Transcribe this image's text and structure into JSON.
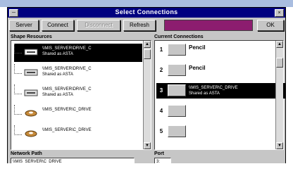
{
  "window": {
    "title": "Select Connections"
  },
  "toolbar": {
    "buttons": [
      {
        "label": "Server"
      },
      {
        "label": "Connect"
      },
      {
        "label": "Disconnect"
      },
      {
        "label": "Refresh"
      },
      {
        "label": "OK"
      }
    ]
  },
  "resources": {
    "label": "Shape Resources",
    "items": [
      {
        "line1": "\\\\MIS_SERVER\\DRIVE_C",
        "line2": "Shared as ASTA",
        "icon": "printer-icon",
        "selected": true
      },
      {
        "line1": "\\\\MIS_SERVER\\DRIVE_C",
        "line2": "Shared as ASTA",
        "icon": "printer-icon",
        "selected": false
      },
      {
        "line1": "\\\\MIS_SERVER\\DRIVE_C",
        "line2": "Shared as ASTA",
        "icon": "printer-icon",
        "selected": false
      },
      {
        "line1": "\\\\MIS_SERVER\\C_DRIVE",
        "line2": "",
        "icon": "disk-icon",
        "selected": false
      },
      {
        "line1": "\\\\MIS_SERVER\\C_DRIVE",
        "line2": "",
        "icon": "disk-icon",
        "selected": false
      }
    ]
  },
  "connections": {
    "label": "Current Connections",
    "ports": [
      {
        "num": "1",
        "text": "Pencil",
        "line1": "",
        "line2": "",
        "selected": false
      },
      {
        "num": "2",
        "text": "Pencil",
        "line1": "",
        "line2": "",
        "selected": false
      },
      {
        "num": "3",
        "text": "",
        "line1": "\\\\MIS_SERVER\\C_DRIVE",
        "line2": "Shared as ASTA",
        "selected": true
      },
      {
        "num": "4",
        "text": "",
        "line1": "",
        "line2": "",
        "selected": false
      },
      {
        "num": "5",
        "text": "",
        "line1": "",
        "line2": "",
        "selected": false
      }
    ]
  },
  "network_path": {
    "label": "Network Path",
    "value": "\\\\MIS_SERVER\\C_DRIVE"
  },
  "port": {
    "label": "Port",
    "value": "3:"
  },
  "colors": {
    "titlebar": "#000080",
    "accent": "#8c1d6f",
    "face": "#c6c6c6"
  }
}
